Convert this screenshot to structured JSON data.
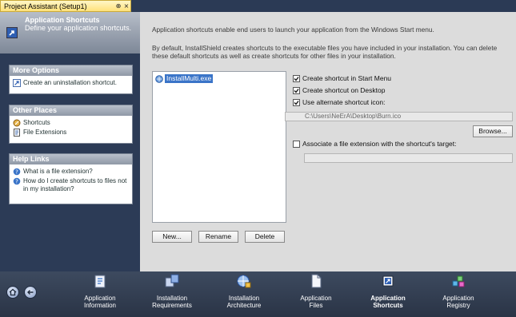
{
  "tab": {
    "title": "Project Assistant (Setup1)",
    "pin_glyph": "⊕",
    "close_glyph": "×"
  },
  "header": {
    "title": "Application Shortcuts",
    "subtitle": "Define your application shortcuts."
  },
  "more_options": {
    "title": "More Options",
    "items": [
      {
        "label": "Create an uninstallation shortcut.",
        "icon": "shortcut-icon"
      }
    ]
  },
  "other_places": {
    "title": "Other Places",
    "items": [
      {
        "label": "Shortcuts",
        "icon": "shortcuts-icon"
      },
      {
        "label": "File Extensions",
        "icon": "file-extension-icon"
      }
    ]
  },
  "help_links": {
    "title": "Help Links",
    "items": [
      {
        "label": "What is a file extension?",
        "icon": "help-icon"
      },
      {
        "label": "How do I create shortcuts to files not in my installation?",
        "icon": "help-icon"
      }
    ]
  },
  "main": {
    "desc1": "Application shortcuts enable end users to launch your application from the Windows Start menu.",
    "desc2": "By default, InstallShield creates shortcuts to the executable files you have included in your installation. You can delete these default shortcuts as well as create shortcuts for other files in your installation.",
    "shortcut_list": [
      "InstallMulti.exe"
    ],
    "buttons": {
      "new": "New...",
      "rename": "Rename",
      "delete": "Delete",
      "browse": "Browse..."
    },
    "options": {
      "start_menu": {
        "label": "Create shortcut in Start Menu",
        "checked": true
      },
      "desktop": {
        "label": "Create shortcut on Desktop",
        "checked": true
      },
      "alt_icon": {
        "label": "Use alternate shortcut icon:",
        "checked": true
      },
      "icon_path": "C:\\Users\\NeErA\\Desktop\\Burn.ico",
      "assoc": {
        "label": "Associate a file extension with the shortcut's target:",
        "checked": false
      },
      "assoc_value": ""
    }
  },
  "nav": {
    "back_glyph": "←",
    "steps": [
      {
        "line1": "Application",
        "line2": "Information",
        "icon": "application-information-icon",
        "active": false
      },
      {
        "line1": "Installation",
        "line2": "Requirements",
        "icon": "installation-requirements-icon",
        "active": false
      },
      {
        "line1": "Installation",
        "line2": "Architecture",
        "icon": "installation-architecture-icon",
        "active": false
      },
      {
        "line1": "Application",
        "line2": "Files",
        "icon": "application-files-icon",
        "active": false
      },
      {
        "line1": "Application",
        "line2": "Shortcuts",
        "icon": "application-shortcuts-icon",
        "active": true
      },
      {
        "line1": "Application",
        "line2": "Registry",
        "icon": "application-registry-icon",
        "active": false
      }
    ]
  },
  "colors": {
    "accent": "#3a74c8",
    "panel_header": "#8f98a6",
    "background": "#dcdcdc",
    "dark": "#2b3a55"
  }
}
